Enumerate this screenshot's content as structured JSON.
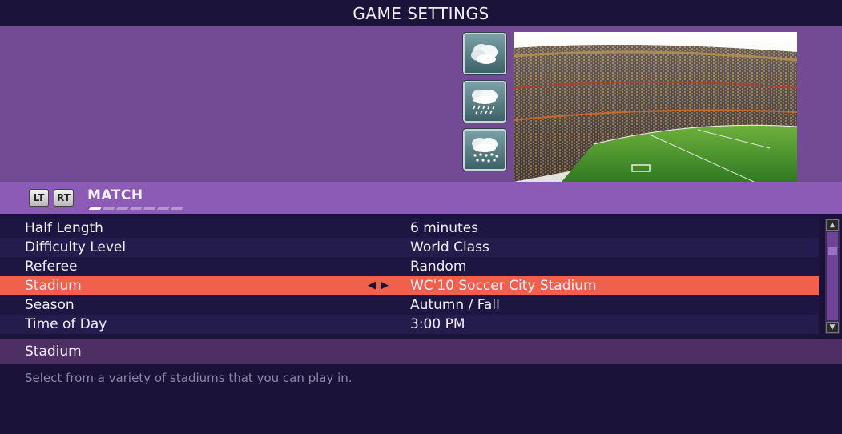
{
  "title": "GAME SETTINGS",
  "weather_buttons": [
    {
      "icon": "cloudy-icon"
    },
    {
      "icon": "rain-icon"
    },
    {
      "icon": "snow-icon"
    }
  ],
  "stadium_preview": {
    "icon": "stadium-preview-image"
  },
  "tabs": {
    "left_trigger": "LT",
    "right_trigger": "RT",
    "current": "MATCH",
    "page_count": 7,
    "active_page": 1
  },
  "settings": [
    {
      "label": "Half Length",
      "value": "6 minutes"
    },
    {
      "label": "Difficulty Level",
      "value": "World Class"
    },
    {
      "label": "Referee",
      "value": "Random"
    },
    {
      "label": "Stadium",
      "value": "WC'10 Soccer City Stadium",
      "selected": true
    },
    {
      "label": "Season",
      "value": "Autumn / Fall"
    },
    {
      "label": "Time of Day",
      "value": "3:00 PM"
    }
  ],
  "selector_arrows": {
    "left": "◀",
    "right": "▶"
  },
  "scrollbar": {
    "up": "▲",
    "down": "▼"
  },
  "description": {
    "heading": "Stadium",
    "text": "Select from a variety of stadiums that you can play in."
  },
  "colors": {
    "selected_row": "#f0604c",
    "preview_bg": "#734b94",
    "tab_strip": "#8b5bb5"
  }
}
